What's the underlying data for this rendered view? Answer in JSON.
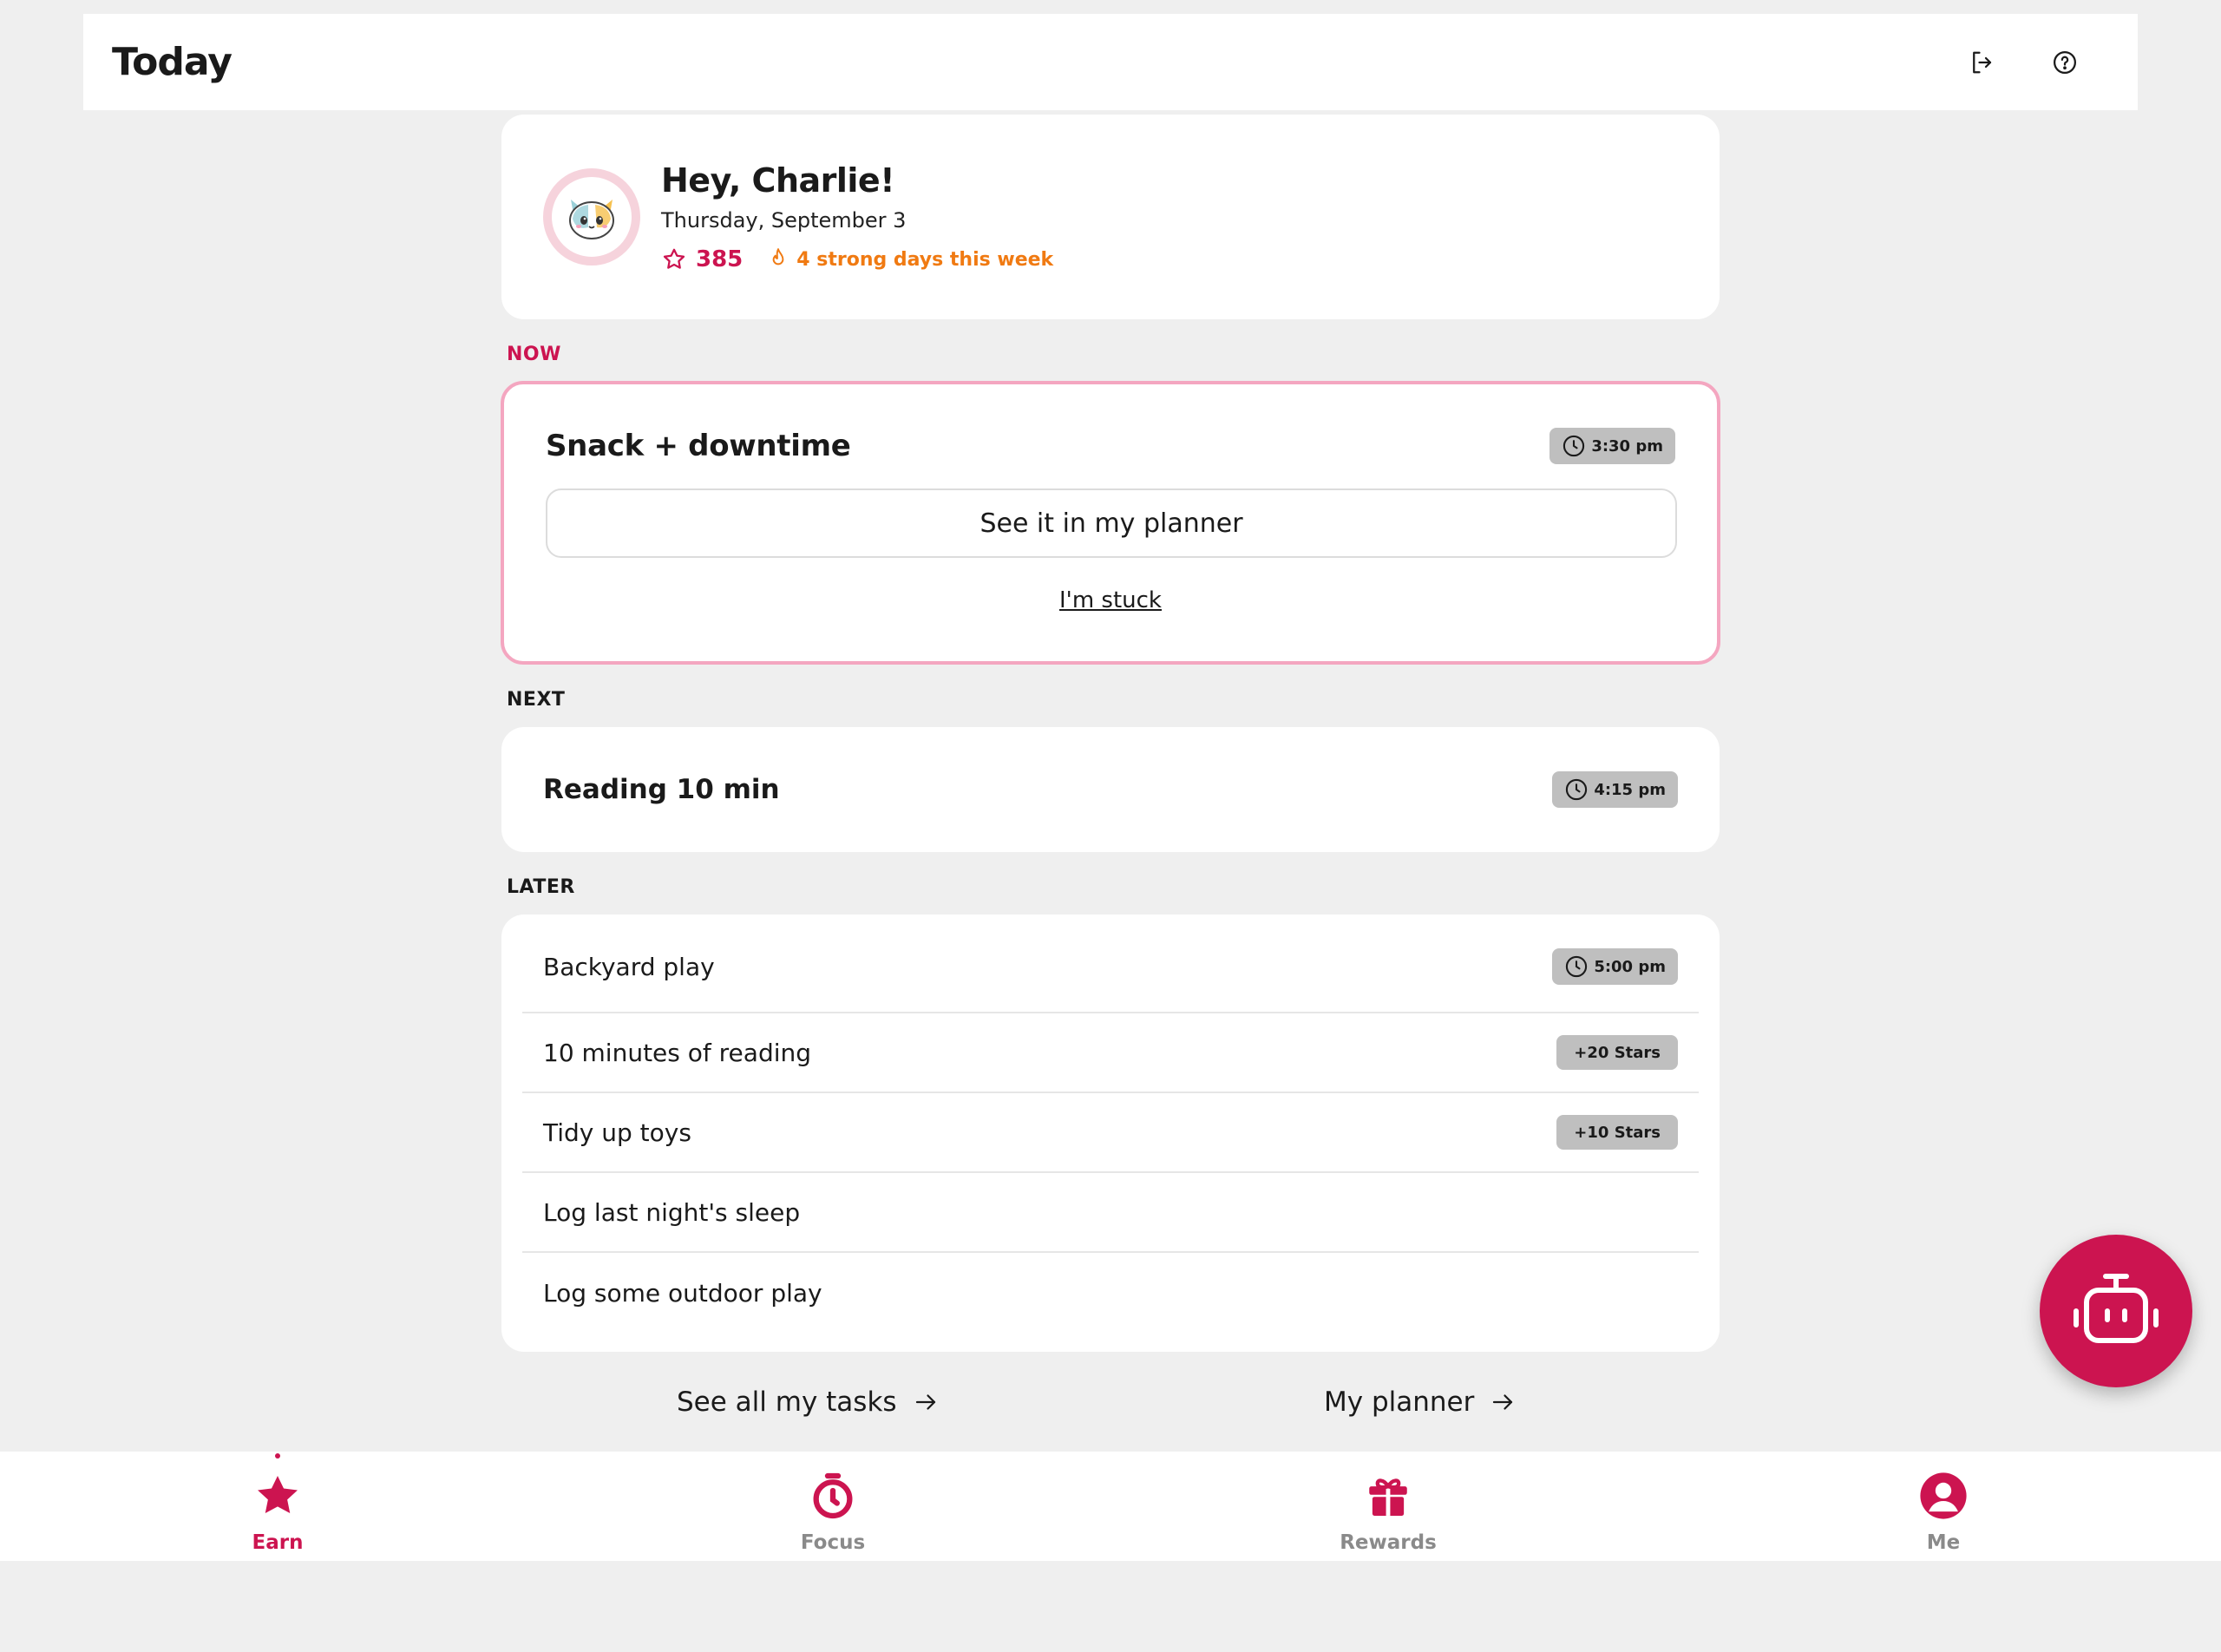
{
  "header": {
    "title": "Today",
    "icons": [
      "logout-icon",
      "help-icon"
    ]
  },
  "greeting": {
    "name": "Hey, Charlie!",
    "date": "Thursday, September 3",
    "stars": "385",
    "streak": "4 strong days this week",
    "avatar_icon": "cat-avatar"
  },
  "now": {
    "label": "NOW",
    "title": "Snack + downtime",
    "time": "3:30 pm",
    "planner_button": "See it in my planner",
    "stuck_link": "I'm stuck"
  },
  "next": {
    "label": "NEXT",
    "title": "Reading 10 min",
    "time": "4:15 pm"
  },
  "later": {
    "label": "LATER",
    "items": [
      {
        "title": "Backyard play",
        "badge": "5:00 pm",
        "badge_type": "time"
      },
      {
        "title": "10 minutes of reading",
        "badge": "+20 Stars",
        "badge_type": "stars"
      },
      {
        "title": "Tidy up toys",
        "badge": "+10 Stars",
        "badge_type": "stars"
      },
      {
        "title": "Log last night's sleep",
        "badge": "",
        "badge_type": "none"
      },
      {
        "title": "Log some outdoor play",
        "badge": "",
        "badge_type": "none"
      }
    ]
  },
  "links": {
    "tasks": "See all my tasks",
    "planner": "My planner"
  },
  "nav": {
    "items": [
      {
        "label": "Earn",
        "icon": "star-icon",
        "active": true
      },
      {
        "label": "Focus",
        "icon": "timer-icon",
        "active": false
      },
      {
        "label": "Rewards",
        "icon": "gift-icon",
        "active": false
      },
      {
        "label": "Me",
        "icon": "person-icon",
        "active": false
      }
    ]
  },
  "colors": {
    "accent": "#cc1450",
    "streak": "#f07a12",
    "now_border": "#f4a6c0",
    "chip": "#bfbfbf",
    "background": "#efefef"
  }
}
